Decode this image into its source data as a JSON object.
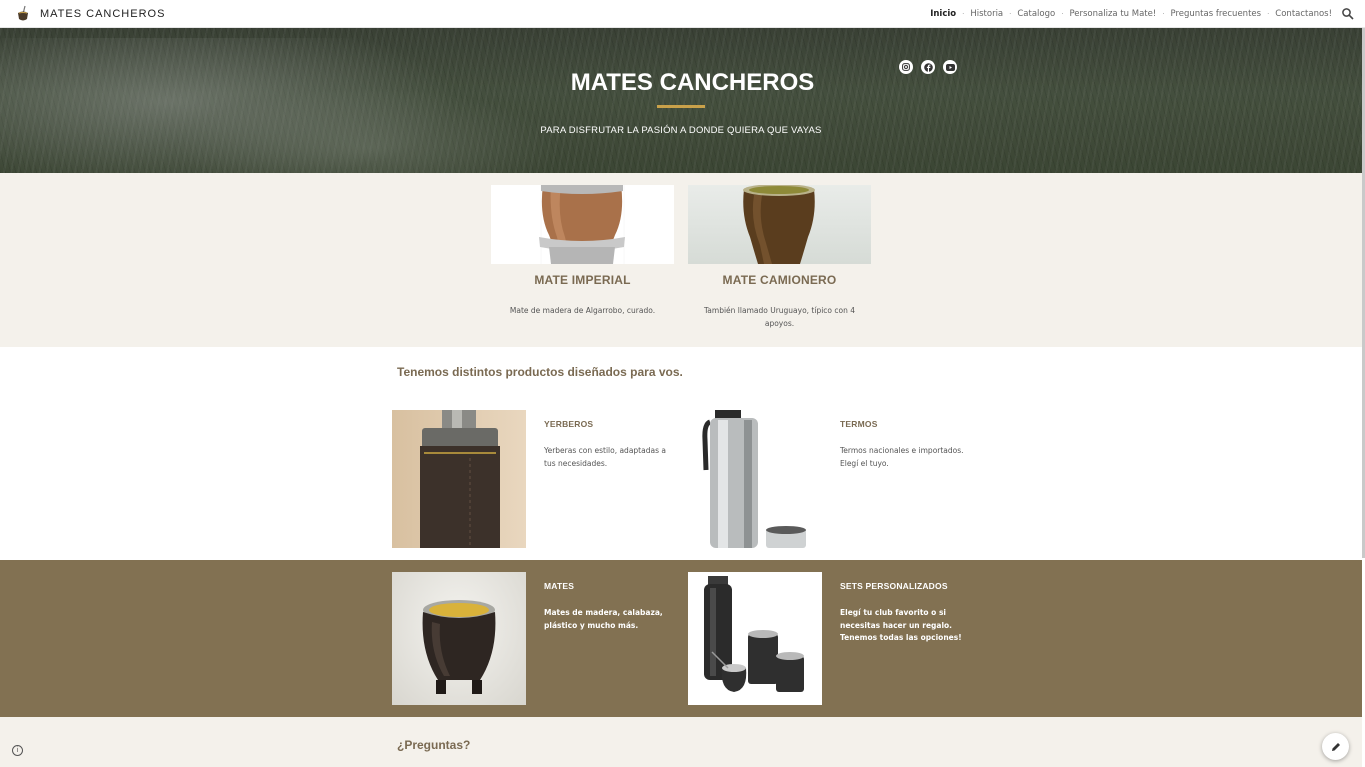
{
  "brand": {
    "title": "MATES CANCHEROS"
  },
  "nav": {
    "items": [
      "Inicio",
      "Historia",
      "Catalogo",
      "Personaliza tu Mate!",
      "Preguntas frecuentes",
      "Contactanos!"
    ],
    "active_index": 0,
    "separator": "·"
  },
  "hero": {
    "title": "MATES CANCHEROS",
    "subtitle": "PARA DISFRUTAR LA PASIÓN A DONDE QUIERA QUE VAYAS",
    "socials": [
      "instagram-icon",
      "facebook-icon",
      "youtube-icon"
    ]
  },
  "featured": [
    {
      "title": "MATE IMPERIAL",
      "description": "Mate de madera de Algarrobo, curado."
    },
    {
      "title": "MATE CAMIONERO",
      "description": "También llamado Uruguayo, típico con 4 apoyos."
    }
  ],
  "products": {
    "section_title": "Tenemos distintos productos diseñados para vos.",
    "items": [
      {
        "title": "YERBEROS",
        "description": "Yerberas con estilo, adaptadas a tus necesidades."
      },
      {
        "title": "TERMOS",
        "description": "Termos nacionales e importados. Elegí el tuyo."
      },
      {
        "title": "MATES",
        "description": "Mates de madera, calabaza, plástico y mucho más."
      },
      {
        "title": "SETS PERSONALIZADOS",
        "description": "Elegí tu club favorito o si necesitas hacer un regalo. Tenemos todas las opciones!"
      }
    ]
  },
  "faq": {
    "title": "¿Preguntas?"
  },
  "colors": {
    "accent": "#c9a14a",
    "brown": "#827152",
    "heading": "#7a6a52",
    "cream": "#f4f1eb"
  }
}
